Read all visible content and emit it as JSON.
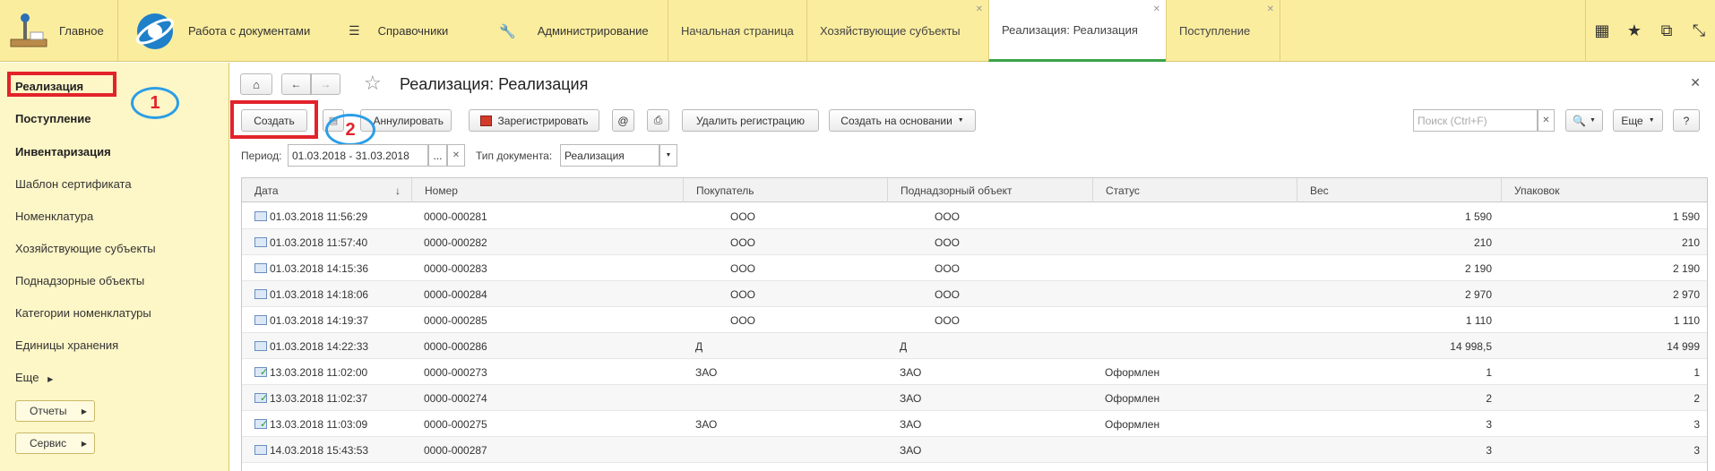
{
  "topbar": {
    "sections": [
      {
        "label": "Главное",
        "icon": "home-desk-icon"
      },
      {
        "label": "Работа с документами",
        "icon": "logo-globe-icon"
      },
      {
        "label": "Справочники",
        "icon": "list-icon"
      },
      {
        "label": "Администрирование",
        "icon": "wrench-icon"
      }
    ],
    "tabs": [
      {
        "label": "Начальная страница",
        "closable": false,
        "active": false
      },
      {
        "label": "Хозяйствующие субъекты",
        "closable": true,
        "active": false
      },
      {
        "label": "Реализация: Реализация",
        "closable": true,
        "active": true
      },
      {
        "label": "Поступление",
        "closable": true,
        "active": false
      }
    ],
    "icons": [
      "grid-icon",
      "star-icon",
      "copy-icon",
      "resize-icon"
    ]
  },
  "sidebar": {
    "items": [
      {
        "label": "Реализация",
        "bold": true
      },
      {
        "label": "Поступление",
        "bold": true
      },
      {
        "label": "Инвентаризация",
        "bold": true
      },
      {
        "label": "Шаблон сертификата",
        "bold": false
      },
      {
        "label": "Номенклатура",
        "bold": false
      },
      {
        "label": "Хозяйствующие субъекты",
        "bold": false
      },
      {
        "label": "Поднадзорные объекты",
        "bold": false
      },
      {
        "label": "Категории номенклатуры",
        "bold": false
      },
      {
        "label": "Единицы хранения",
        "bold": false
      },
      {
        "label": "Еще",
        "bold": false
      }
    ],
    "buttons": [
      "Отчеты",
      "Сервис"
    ]
  },
  "annotations": {
    "one": "1",
    "two": "2"
  },
  "main": {
    "title": "Реализация: Реализация",
    "toolbar": {
      "create": "Создать",
      "annul": "Аннулировать",
      "register": "Зарегистрировать",
      "at": "@",
      "delete_reg": "Удалить регистрацию",
      "create_based": "Создать на основании",
      "search_placeholder": "Поиск (Ctrl+F)",
      "more": "Еще",
      "help": "?"
    },
    "filters": {
      "period_label": "Период:",
      "period_value": "01.03.2018 - 31.03.2018",
      "period_btn": "...",
      "doc_type_label": "Тип документа:",
      "doc_type_value": "Реализация"
    },
    "columns": [
      "Дата",
      "Номер",
      "Покупатель",
      "Поднадзорный объект",
      "Статус",
      "Вес",
      "Упаковок"
    ],
    "rows": [
      {
        "date": "01.03.2018 11:56:29",
        "number": "0000-000281",
        "buyer": "ООО",
        "object": "ООО",
        "status": "",
        "weight": "1 590",
        "packs": "1 590",
        "ok": false
      },
      {
        "date": "01.03.2018 11:57:40",
        "number": "0000-000282",
        "buyer": "ООО",
        "object": "ООО",
        "status": "",
        "weight": "210",
        "packs": "210",
        "ok": false
      },
      {
        "date": "01.03.2018 14:15:36",
        "number": "0000-000283",
        "buyer": "ООО",
        "object": "ООО",
        "status": "",
        "weight": "2 190",
        "packs": "2 190",
        "ok": false
      },
      {
        "date": "01.03.2018 14:18:06",
        "number": "0000-000284",
        "buyer": "ООО",
        "object": "ООО",
        "status": "",
        "weight": "2 970",
        "packs": "2 970",
        "ok": false
      },
      {
        "date": "01.03.2018 14:19:37",
        "number": "0000-000285",
        "buyer": "ООО",
        "object": "ООО",
        "status": "",
        "weight": "1 110",
        "packs": "1 110",
        "ok": false
      },
      {
        "date": "01.03.2018 14:22:33",
        "number": "0000-000286",
        "buyer": "Д",
        "object": "Д",
        "status": "",
        "weight": "14 998,5",
        "packs": "14 999",
        "ok": false
      },
      {
        "date": "13.03.2018 11:02:00",
        "number": "0000-000273",
        "buyer": "ЗАО",
        "object": "ЗАО",
        "status": "Оформлен",
        "weight": "1",
        "packs": "1",
        "ok": true
      },
      {
        "date": "13.03.2018 11:02:37",
        "number": "0000-000274",
        "buyer": "",
        "object": "ЗАО",
        "status": "Оформлен",
        "weight": "2",
        "packs": "2",
        "ok": true
      },
      {
        "date": "13.03.2018 11:03:09",
        "number": "0000-000275",
        "buyer": "ЗАО",
        "object": "ЗАО",
        "status": "Оформлен",
        "weight": "3",
        "packs": "3",
        "ok": true
      },
      {
        "date": "14.03.2018 15:43:53",
        "number": "0000-000287",
        "buyer": "",
        "object": "ЗАО",
        "status": "",
        "weight": "3",
        "packs": "3",
        "ok": false
      }
    ]
  }
}
